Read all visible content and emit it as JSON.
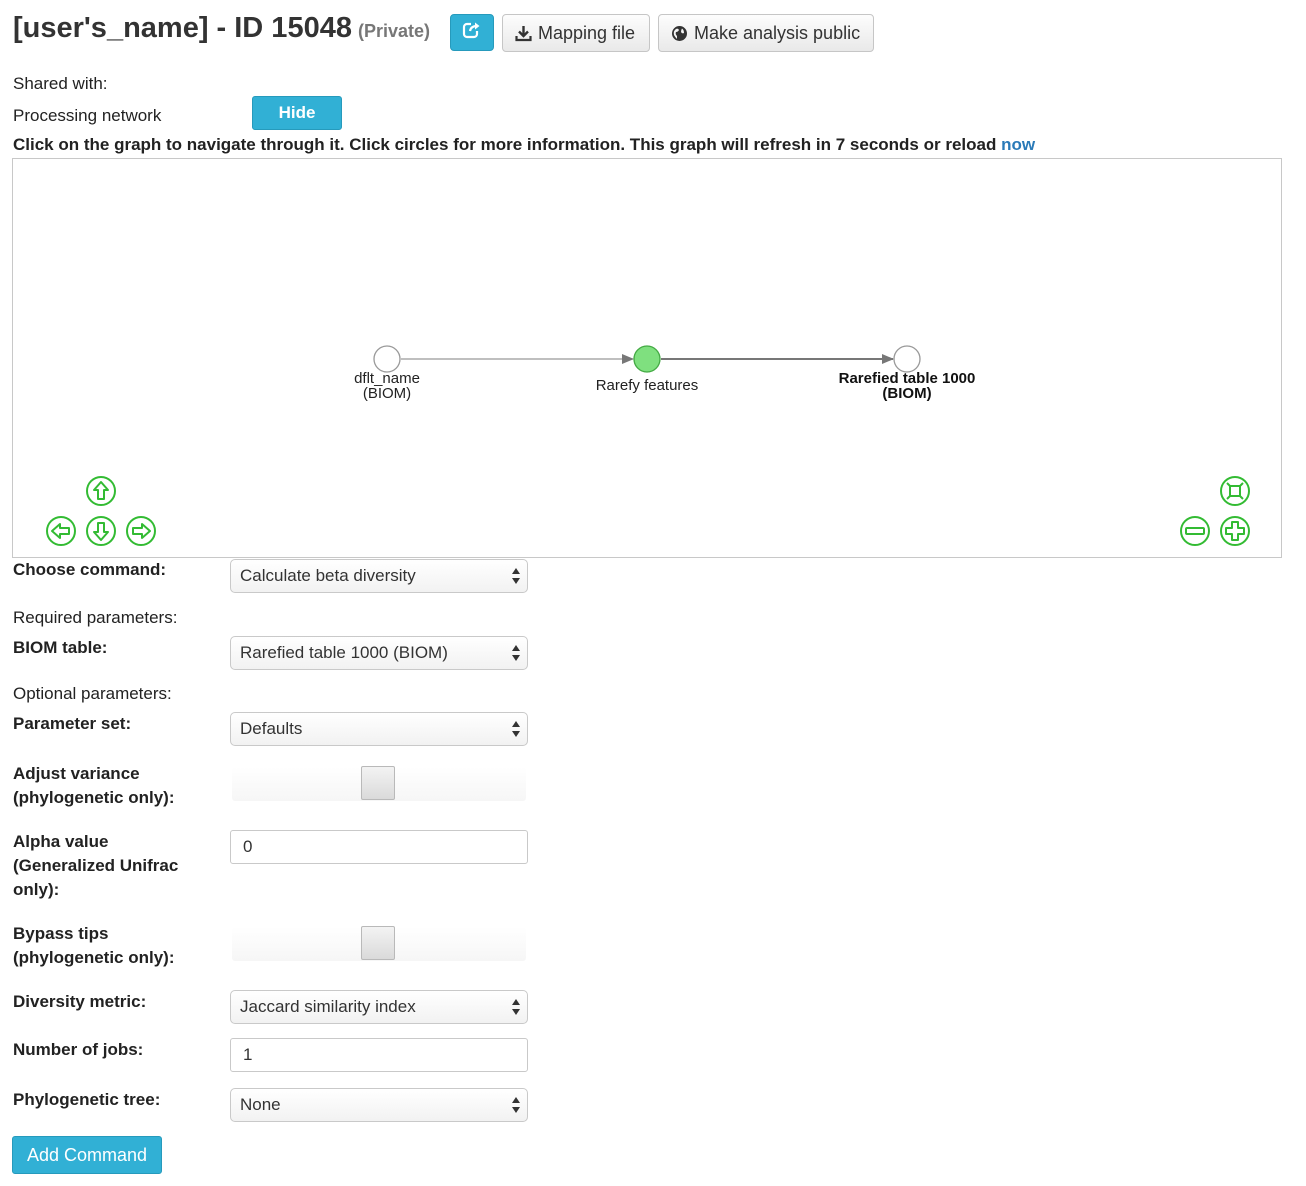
{
  "header": {
    "title": "[user's_name] - ID 15048",
    "privacy": "(Private)",
    "share_icon": "share-icon",
    "mapping_label": "Mapping file",
    "mapping_icon": "download-icon",
    "public_label": "Make analysis public",
    "public_icon": "globe-icon"
  },
  "shared_with_label": "Shared with:",
  "processing_network_label": "Processing network",
  "hide_label": "Hide",
  "info": {
    "text": "Click on the graph to navigate through it. Click circles for more information. This graph will refresh in 7 seconds or reload",
    "link": "now"
  },
  "graph": {
    "nodes": [
      {
        "line1": "dflt_name",
        "line2": "(BIOM)",
        "bold": false,
        "fill": "#ffffff"
      },
      {
        "line1": "Rarefy features",
        "line2": "",
        "bold": false,
        "fill": "#7fe07f"
      },
      {
        "line1": "Rarefied table 1000",
        "line2": "(BIOM)",
        "bold": true,
        "fill": "#ffffff"
      }
    ],
    "nav_icons": [
      "arrow-up-icon",
      "arrow-left-icon",
      "arrow-down-icon",
      "arrow-right-icon",
      "fit-icon",
      "zoom-out-icon",
      "zoom-in-icon"
    ],
    "accent_color": "#33bb33"
  },
  "form": {
    "choose_command": {
      "label": "Choose command:",
      "value": "Calculate beta diversity"
    },
    "required_label": "Required parameters:",
    "biom_table": {
      "label": "BIOM table:",
      "value": "Rarefied table 1000 (BIOM)"
    },
    "optional_label": "Optional parameters:",
    "parameter_set": {
      "label": "Parameter set:",
      "value": "Defaults"
    },
    "adjust_variance": {
      "label1": "Adjust variance",
      "label2": "(phylogenetic only):"
    },
    "alpha_value": {
      "label1": "Alpha value",
      "label2": "(Generalized Unifrac",
      "label3": "only):",
      "value": "0"
    },
    "bypass_tips": {
      "label1": "Bypass tips",
      "label2": "(phylogenetic only):"
    },
    "diversity_metric": {
      "label": "Diversity metric:",
      "value": "Jaccard similarity index"
    },
    "number_of_jobs": {
      "label": "Number of jobs:",
      "value": "1"
    },
    "phylogenetic_tree": {
      "label": "Phylogenetic tree:",
      "value": "None"
    },
    "add_command_label": "Add Command"
  }
}
